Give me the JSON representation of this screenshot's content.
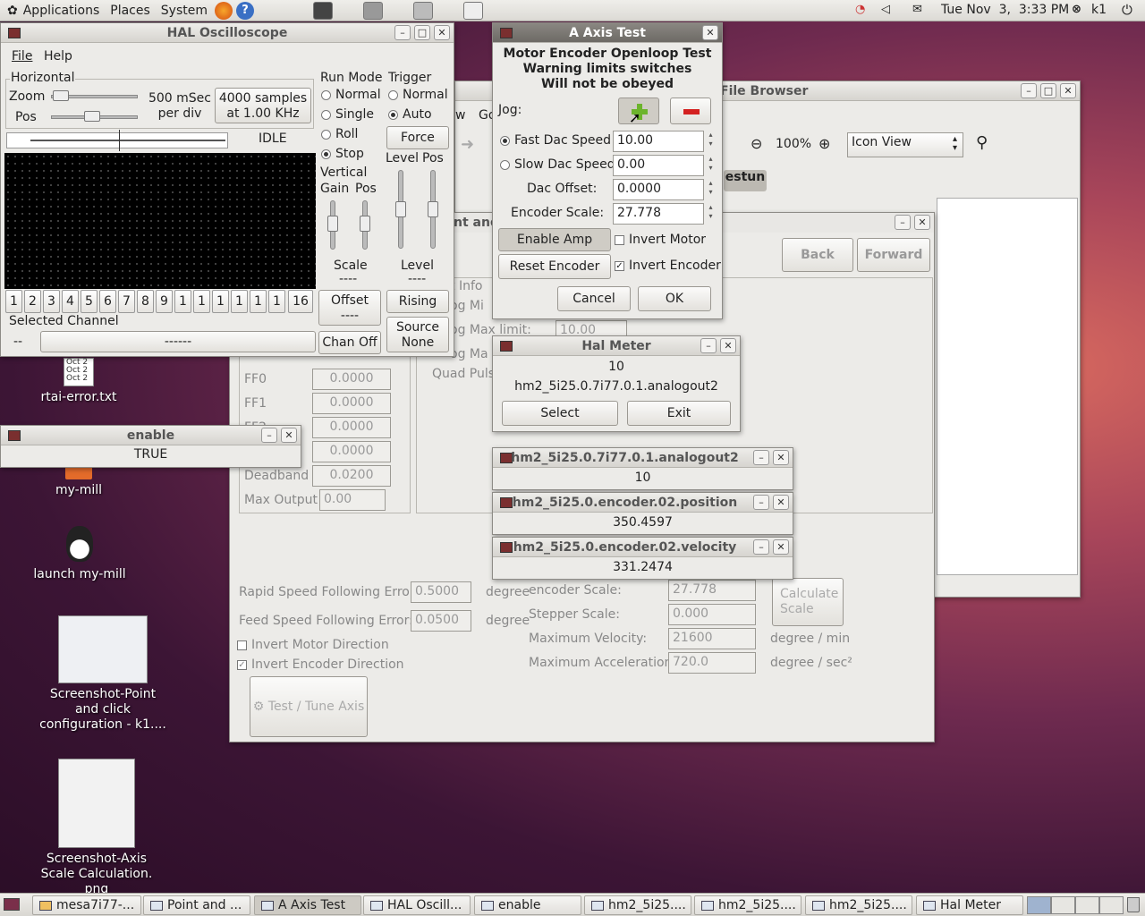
{
  "top_panel": {
    "menus": [
      "Applications",
      "Places",
      "System"
    ],
    "clock": "Tue Nov  3,  3:33 PM",
    "user": "k1"
  },
  "desktop_icons": {
    "rtai": "rtai-error.txt",
    "rtai_thumb_lines": [
      "Oct 2",
      "Oct 2",
      "Oct 2"
    ],
    "mymill": "my-mill",
    "launch": "launch my-mill",
    "shot1": "Screenshot-Point and click configuration - k1....",
    "shot2": "Screenshot-Axis Scale Calculation. png"
  },
  "scope": {
    "title": "HAL Oscilloscope",
    "menu_file": "File",
    "menu_help": "Help",
    "horizontal": "Horizontal",
    "zoom": "Zoom",
    "pos": "Pos",
    "rate_line1": "500 mSec",
    "rate_line2": "per div",
    "samples_line1": "4000 samples",
    "samples_line2": "at 1.00 KHz",
    "state": "IDLE",
    "run_mode": "Run Mode",
    "run_options": [
      "Normal",
      "Single",
      "Roll",
      "Stop"
    ],
    "trigger": "Trigger",
    "trig_options": [
      "Normal",
      "Auto"
    ],
    "force": "Force",
    "level": "Level",
    "tpos": "Pos",
    "vertical": "Vertical",
    "gain": "Gain",
    "vpos": "Pos",
    "scale": "Scale",
    "scale_val": "----",
    "tlevel": "Level",
    "tlevel_val": "----",
    "offset": "Offset",
    "offset_val": "----",
    "rising": "Rising",
    "source": "Source",
    "source_val": "None",
    "channels": [
      "1",
      "2",
      "3",
      "4",
      "5",
      "6",
      "7",
      "8",
      "9",
      "1",
      "1",
      "1",
      "1",
      "1",
      "1",
      "16"
    ],
    "selected_channel": "Selected Channel",
    "sel_id": "--",
    "sel_name": "------",
    "chan_off": "Chan Off"
  },
  "enable": {
    "title": "enable",
    "value": "TRUE"
  },
  "axis_test": {
    "title": "A Axis Test",
    "warn1": "Motor Encoder Openloop Test",
    "warn2": "Warning limits switches",
    "warn3": "Will not be obeyed",
    "jog": "Jog:",
    "fast": "Fast Dac Speed",
    "fast_val": "10.00",
    "slow": "Slow Dac Speed",
    "slow_val": "0.00",
    "offset": "Dac Offset:",
    "offset_val": "0.0000",
    "enc_scale": "Encoder Scale:",
    "enc_scale_val": "27.778",
    "enable_amp": "Enable Amp",
    "invert_motor": "Invert Motor",
    "reset_encoder": "Reset Encoder",
    "invert_encoder": "Invert Encoder",
    "cancel": "Cancel",
    "ok": "OK"
  },
  "file_browser": {
    "title": "File Browser",
    "zoom": "100%",
    "view": "Icon View",
    "crumb": "estun",
    "back": "Back",
    "forward": "Forward",
    "menu_partial": [
      "w",
      "Go"
    ]
  },
  "pncconf": {
    "title_partial": "nt and",
    "ghost_labels": [
      "t Info",
      "og Mi",
      "og Max limit:",
      "og Ma",
      "Quad Pulse"
    ],
    "ghost_max_limit_val": "10.00",
    "ff0": "FF0",
    "ff0_val": "0.0000",
    "ff1": "FF1",
    "ff1_val": "0.0000",
    "ff2": "FF2",
    "ff2_val": "0.0000",
    "row4_val": "0.0000",
    "deadband": "Deadband",
    "deadband_val": "0.0200",
    "max_output": "Max Output",
    "max_output_val": "0.00",
    "rapid": "Rapid Speed Following Error:",
    "rapid_val": "0.5000",
    "feed": "Feed Speed Following Error:",
    "feed_val": "0.0500",
    "degree": "degree",
    "invert_motor_dir": "Invert Motor Direction",
    "invert_enc_dir": "Invert Encoder Direction",
    "test_tune": "Test / Tune Axis",
    "encoder_scale": "encoder Scale:",
    "encoder_scale_val": "27.778",
    "stepper_scale": "Stepper Scale:",
    "stepper_scale_val": "0.000",
    "max_vel": "Maximum Velocity:",
    "max_vel_val": "21600",
    "max_vel_unit": "degree / min",
    "max_acc": "Maximum Acceleration:",
    "max_acc_val": "720.0",
    "max_acc_unit": "degree / sec²",
    "calc_line1": "Calculate",
    "calc_line2": "Scale"
  },
  "hal_meter": {
    "title": "Hal Meter",
    "value": "10",
    "pin": "hm2_5i25.0.7i77.0.1.analogout2",
    "select": "Select",
    "exit": "Exit"
  },
  "meters": [
    {
      "title": "hm2_5i25.0.7i77.0.1.analogout2",
      "value": "10"
    },
    {
      "title": "hm2_5i25.0.encoder.02.position",
      "value": "350.4597"
    },
    {
      "title": "hm2_5i25.0.encoder.02.velocity",
      "value": "331.2474"
    }
  ],
  "taskbar": [
    "mesa7i77-...",
    "Point and ...",
    "A Axis Test",
    "HAL Oscill...",
    "enable",
    "hm2_5i25....",
    "hm2_5i25....",
    "hm2_5i25....",
    "Hal Meter"
  ]
}
